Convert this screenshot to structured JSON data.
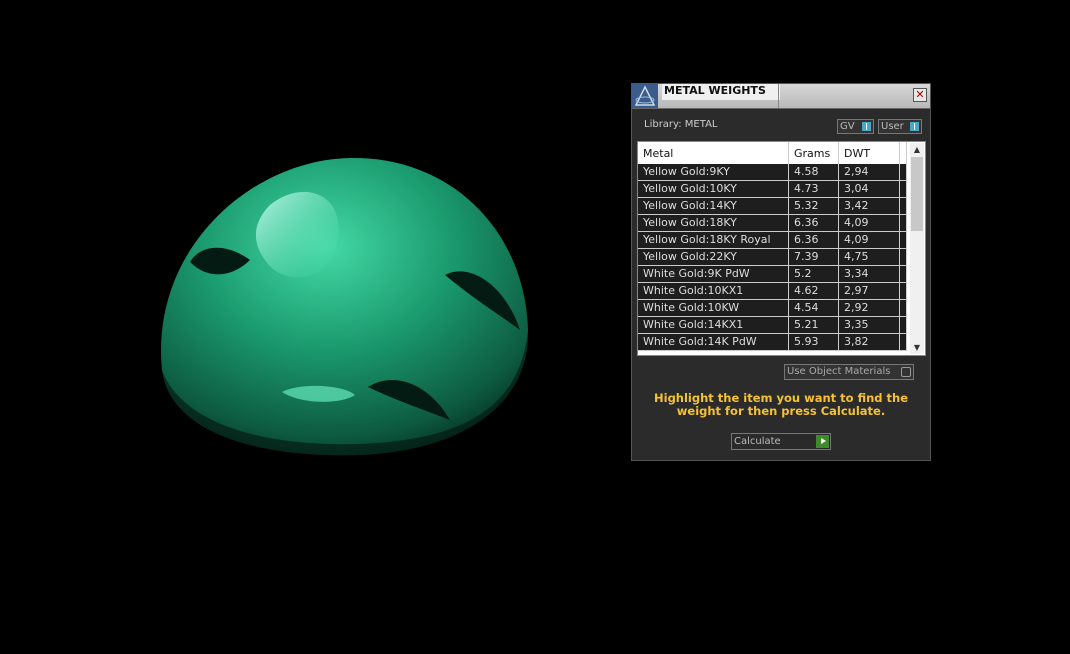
{
  "panel": {
    "title": "METAL WEIGHTS",
    "close_label": "✕",
    "library_label": "Library: METAL",
    "toggle_gv": "GV",
    "toggle_user": "User",
    "columns": [
      "Metal",
      "Grams",
      "DWT"
    ],
    "rows": [
      {
        "metal": "Yellow Gold:9KY",
        "grams": "4.58",
        "dwt": "2,94"
      },
      {
        "metal": "Yellow Gold:10KY",
        "grams": "4.73",
        "dwt": "3,04"
      },
      {
        "metal": "Yellow Gold:14KY",
        "grams": "5.32",
        "dwt": "3,42"
      },
      {
        "metal": "Yellow Gold:18KY",
        "grams": "6.36",
        "dwt": "4,09"
      },
      {
        "metal": "Yellow Gold:18KY Royal",
        "grams": "6.36",
        "dwt": "4,09"
      },
      {
        "metal": "Yellow Gold:22KY",
        "grams": "7.39",
        "dwt": "4,75"
      },
      {
        "metal": "White Gold:9K PdW",
        "grams": "5.2",
        "dwt": "3,34"
      },
      {
        "metal": "White Gold:10KX1",
        "grams": "4.62",
        "dwt": "2,97"
      },
      {
        "metal": "White Gold:10KW",
        "grams": "4.54",
        "dwt": "2,92"
      },
      {
        "metal": "White Gold:14KX1",
        "grams": "5.21",
        "dwt": "3,35"
      },
      {
        "metal": "White Gold:14K PdW",
        "grams": "5.93",
        "dwt": "3,82"
      }
    ],
    "use_object_materials": "Use Object Materials",
    "hint": "Highlight the item you want to find the weight for then press Calculate.",
    "calculate_label": "Calculate"
  },
  "colors": {
    "object_green": "#1f9a6e",
    "hint_yellow": "#f6c233",
    "toggle_blue": "#4aa7c8",
    "play_green": "#3f8a2a"
  }
}
